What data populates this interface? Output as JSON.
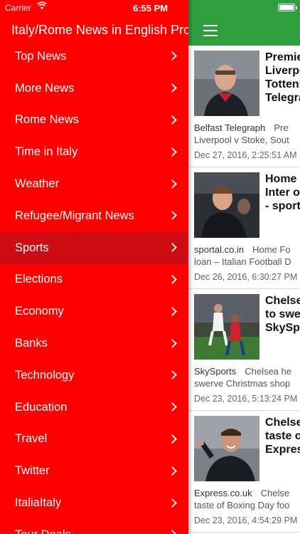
{
  "status_bar": {
    "carrier": "Carrier",
    "time": "6:55 PM"
  },
  "drawer": {
    "title": "Italy/Rome News in English Pro",
    "accent_color": "#ff0000",
    "selected_color": "#cc0c12",
    "items": [
      {
        "label": "Top News",
        "selected": false
      },
      {
        "label": "More News",
        "selected": false
      },
      {
        "label": "Rome News",
        "selected": false
      },
      {
        "label": "Time in Italy",
        "selected": false
      },
      {
        "label": "Weather",
        "selected": false
      },
      {
        "label": "Refugee/Migrant News",
        "selected": false
      },
      {
        "label": "Sports",
        "selected": true
      },
      {
        "label": "Elections",
        "selected": false
      },
      {
        "label": "Economy",
        "selected": false
      },
      {
        "label": "Banks",
        "selected": false
      },
      {
        "label": "Technology",
        "selected": false
      },
      {
        "label": "Education",
        "selected": false
      },
      {
        "label": "Travel",
        "selected": false
      },
      {
        "label": "Twitter",
        "selected": false
      },
      {
        "label": "ItaliaItaly",
        "selected": false
      },
      {
        "label": "Tour Deals",
        "selected": false
      }
    ]
  },
  "appbar": {
    "color": "#2e9e3f",
    "menu_icon": "hamburger-menu-icon"
  },
  "articles": [
    {
      "headline": "Premie\nLiverpo\nTottenh\nTelegra",
      "source": "Belfast Telegraph",
      "snippet_1": "Pre",
      "snippet_2": "Liverpool v Stoke, Sout",
      "date": "Dec 27, 2016, 2:25:51 AM"
    },
    {
      "headline": "Home F\nInter on\n- sportal",
      "source": "sportal.co.in",
      "snippet_1": "Home Fo",
      "snippet_2": "loan – Italian Football D",
      "date": "Dec 26, 2016, 6:30:27 PM"
    },
    {
      "headline": "Chelse\nto swer\nSkySpo",
      "source": "SkySports",
      "snippet_1": "Chelsea he",
      "snippet_2": "swerve Christmas shop",
      "date": "Dec 23, 2016, 5:13:24 PM"
    },
    {
      "headline": "Chelse\ntaste o\nExpres",
      "source": "Express.co.uk",
      "snippet_1": "Chelse",
      "snippet_2": "taste of Boxing Day foo",
      "date": "Dec 23, 2016, 4:54:29 PM"
    }
  ]
}
